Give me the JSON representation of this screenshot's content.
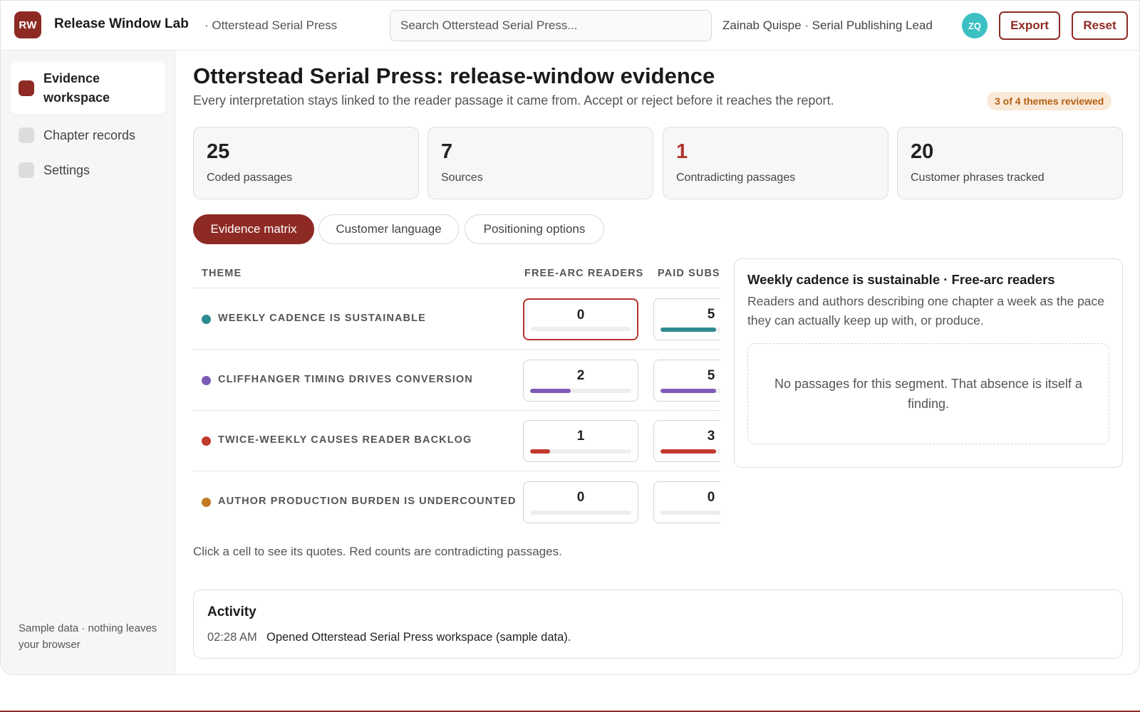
{
  "header": {
    "logo_initials": "RW",
    "app_name": "Release Window Lab",
    "workspace": "· Otterstead Serial Press",
    "search_placeholder": "Search Otterstead Serial Press...",
    "user": "Zainab Quispe · Serial Publishing Lead",
    "avatar_initials": "ZQ",
    "avatar_color": "#3cc0c4",
    "export_label": "Export",
    "reset_label": "Reset",
    "accent_color": "#8e2a24"
  },
  "sidebar": {
    "items": [
      {
        "label": "Evidence workspace",
        "active": true
      },
      {
        "label": "Chapter records",
        "active": false
      },
      {
        "label": "Settings",
        "active": false
      }
    ],
    "footer": "Sample data · nothing leaves your browser"
  },
  "page": {
    "title": "Otterstead Serial Press: release-window evidence",
    "subtitle": "Every interpretation stays linked to the reader passage it came from. Accept or reject before it reaches the report.",
    "review_badge": "3 of 4 themes reviewed"
  },
  "stats": [
    {
      "value": "25",
      "label": "Coded passages"
    },
    {
      "value": "7",
      "label": "Sources"
    },
    {
      "value": "1",
      "label": "Contradicting passages",
      "highlight": "#b2342e"
    },
    {
      "value": "20",
      "label": "Customer phrases tracked"
    }
  ],
  "tabs": [
    {
      "label": "Evidence matrix",
      "active": true
    },
    {
      "label": "Customer language",
      "active": false
    },
    {
      "label": "Positioning options",
      "active": false
    }
  ],
  "matrix": {
    "columns": [
      "THEME",
      "FREE-ARC READERS",
      "PAID SUBS"
    ],
    "rows": [
      {
        "theme": "WEEKLY CADENCE IS SUSTAINABLE",
        "color": "#2e8a8f",
        "cells": [
          {
            "value": "0",
            "fraction": 0,
            "selected": true
          },
          {
            "value": "5",
            "fraction": 0.55
          }
        ]
      },
      {
        "theme": "CLIFFHANGER TIMING DRIVES CONVERSION",
        "color": "#7e5bb5",
        "cells": [
          {
            "value": "2",
            "fraction": 0.4
          },
          {
            "value": "5",
            "fraction": 0.55
          }
        ]
      },
      {
        "theme": "TWICE-WEEKLY CAUSES READER BACKLOG",
        "color": "#c2392e",
        "cells": [
          {
            "value": "1",
            "fraction": 0.2
          },
          {
            "value": "3",
            "fraction": 0.55
          }
        ]
      },
      {
        "theme": "AUTHOR PRODUCTION BURDEN IS UNDERCOUNTED",
        "color": "#c17a22",
        "cells": [
          {
            "value": "0",
            "fraction": 0
          },
          {
            "value": "0",
            "fraction": 0
          }
        ]
      }
    ],
    "note": "Click a cell to see its quotes. Red counts are contradicting passages."
  },
  "detail": {
    "title": "Weekly cadence is sustainable · Free-arc readers",
    "description": "Readers and authors describing one chapter a week as the pace they can actually keep up with, or produce.",
    "empty_message": "No passages for this segment. That absence is itself a finding."
  },
  "activity": {
    "title": "Activity",
    "entries": [
      {
        "time": "02:28 AM",
        "text": "Opened Otterstead Serial Press workspace (sample data)."
      }
    ]
  }
}
